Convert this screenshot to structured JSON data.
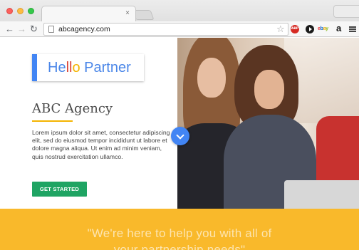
{
  "browser": {
    "tab_close_glyph": "×",
    "url": "abcagency.com",
    "extensions": {
      "adblock_label": "ABP",
      "ebay_letters": [
        "e",
        "b",
        "a",
        "y"
      ],
      "amazon_label": "a"
    },
    "icons": [
      "back-arrow-icon",
      "forward-arrow-icon",
      "reload-icon",
      "page-icon",
      "star-icon",
      "play-icon",
      "menu-icon"
    ]
  },
  "page": {
    "logo": {
      "prefix": "He",
      "red": "ll",
      "yellow": "o",
      "suffix": " Partner"
    },
    "company_name": "ABC Agency",
    "body_text": "Lorem ipsum dolor sit amet, consectetur adipiscing elit, sed do eiusmod tempor incididunt ut labore et dolore magna aliqua. Ut enim ad minim veniam, quis nostrud exercitation ullamco.",
    "cta_label": "GET STARTED",
    "quote_line1": "\"We're here to help you with all of",
    "quote_line2": "your partnership needs\""
  },
  "colors": {
    "brand_blue": "#4285f4",
    "brand_red": "#db4437",
    "brand_yellow": "#f4b400",
    "cta_green": "#1fa463",
    "band_yellow": "#f9b92b"
  }
}
